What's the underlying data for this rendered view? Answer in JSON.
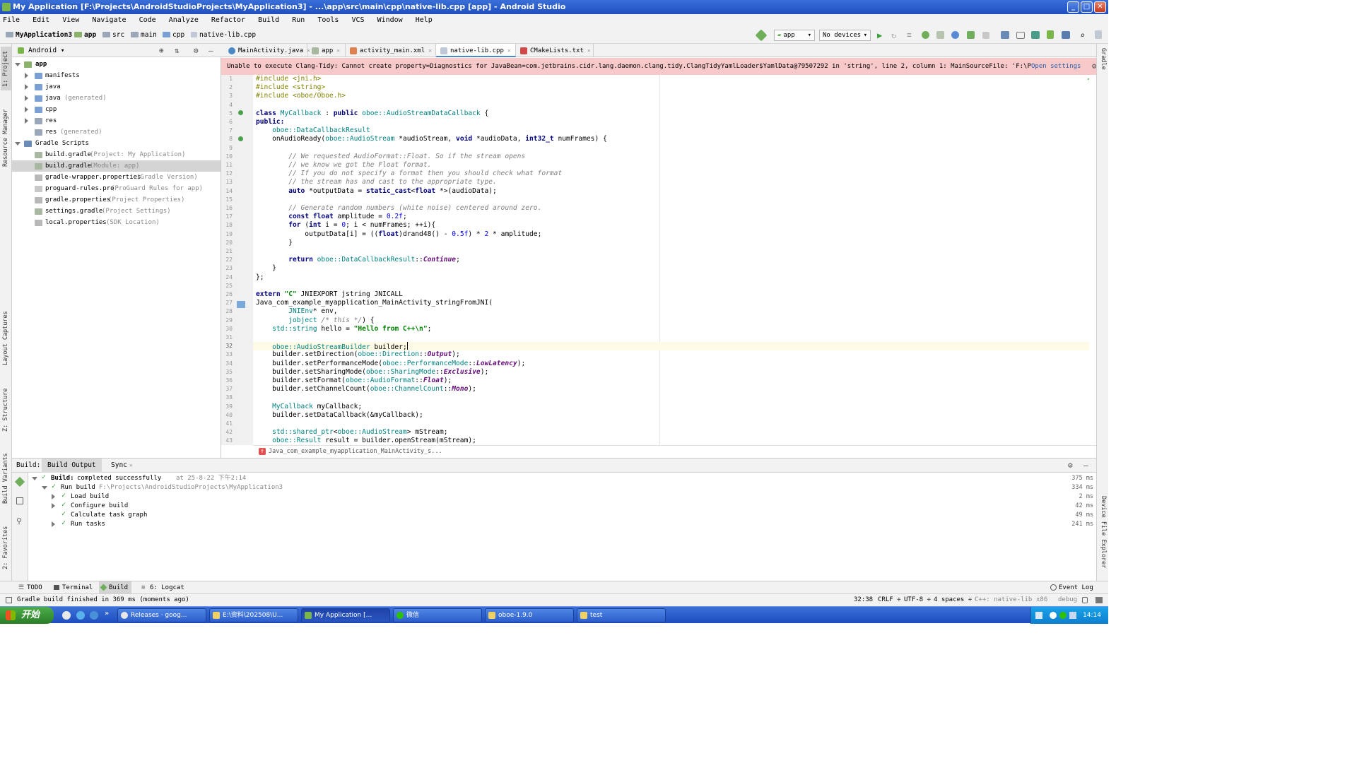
{
  "window": {
    "title": "My Application [F:\\Projects\\AndroidStudioProjects\\MyApplication3] - ...\\app\\src\\main\\cpp\\native-lib.cpp [app] - Android Studio",
    "minimize": "_",
    "maximize": "□",
    "close": "✕"
  },
  "menu": [
    "File",
    "Edit",
    "View",
    "Navigate",
    "Code",
    "Analyze",
    "Refactor",
    "Build",
    "Run",
    "Tools",
    "VCS",
    "Window",
    "Help"
  ],
  "breadcrumb": [
    "MyApplication3",
    "app",
    "src",
    "main",
    "cpp",
    "native-lib.cpp"
  ],
  "toolbar": {
    "run_config": "app",
    "device": "No devices"
  },
  "left_tool_tabs": [
    "1: Project",
    "Resource Manager",
    "Layout Captures",
    "Z: Structure",
    "Build Variants",
    "2: Favorites"
  ],
  "right_tool_tabs": [
    "Gradle",
    "Device File Explorer"
  ],
  "project_panel": {
    "view_mode": "Android",
    "tree": [
      {
        "label": "app",
        "note": ""
      },
      {
        "label": "manifests",
        "note": ""
      },
      {
        "label": "java",
        "note": ""
      },
      {
        "label": "java",
        "note": "(generated)"
      },
      {
        "label": "cpp",
        "note": ""
      },
      {
        "label": "res",
        "note": ""
      },
      {
        "label": "res",
        "note": "(generated)"
      },
      {
        "label": "Gradle Scripts",
        "note": ""
      },
      {
        "label": "build.gradle",
        "note": "(Project: My Application)"
      },
      {
        "label": "build.gradle",
        "note": "(Module: app)"
      },
      {
        "label": "gradle-wrapper.properties",
        "note": "(Gradle Version)"
      },
      {
        "label": "proguard-rules.pro",
        "note": "(ProGuard Rules for app)"
      },
      {
        "label": "gradle.properties",
        "note": "(Project Properties)"
      },
      {
        "label": "settings.gradle",
        "note": "(Project Settings)"
      },
      {
        "label": "local.properties",
        "note": "(SDK Location)"
      }
    ]
  },
  "editor_tabs": [
    "MainActivity.java",
    "app",
    "activity_main.xml",
    "native-lib.cpp",
    "CMakeLists.txt"
  ],
  "banner": {
    "message": "Unable to execute Clang-Tidy: Cannot create property=Diagnostics for JavaBean=com.jetbrains.cidr.lang.daemon.clang.tidy.ClangTidyYamlLoader$YamlData@79507292 in 'string', line 2, column 1:    MainSourceFile:  'F:\\Projects\\An ...",
    "link": "Open settings"
  },
  "code_lines": [
    "1",
    "2",
    "3",
    "4",
    "5",
    "6",
    "7",
    "8",
    "9",
    "10",
    "11",
    "12",
    "13",
    "14",
    "15",
    "16",
    "17",
    "18",
    "19",
    "20",
    "21",
    "22",
    "23",
    "24",
    "25",
    "26",
    "27",
    "28",
    "29",
    "30",
    "31",
    "32",
    "33",
    "34",
    "35",
    "36",
    "37",
    "38",
    "39",
    "40",
    "41",
    "42",
    "43"
  ],
  "code": {
    "l1": "#include <jni.h>",
    "l2": "#include <string>",
    "l3": "#include <oboe/Oboe.h>",
    "l5a": "class ",
    "l5b": "MyCallback",
    "l5c": " : ",
    "l5d": "public",
    "l5e": " oboe::",
    "l5f": "AudioStreamDataCallback",
    "l5g": " {",
    "l6": "public:",
    "l7a": "    oboe::",
    "l7b": "DataCallbackResult",
    "l8a": "    onAudioReady(",
    "l8b": "oboe::",
    "l8c": "AudioStream",
    "l8d": " *audioStream, ",
    "l8e": "void",
    "l8f": " *audioData, ",
    "l8g": "int32_t",
    "l8h": " numFrames) {",
    "l10": "        // We requested AudioFormat::Float. So if the stream opens",
    "l11": "        // we know we got the Float format.",
    "l12": "        // If you do not specify a format then you should check what format",
    "l13": "        // the stream has and cast to the appropriate type.",
    "l14a": "        ",
    "l14b": "auto",
    "l14c": " *outputData = ",
    "l14d": "static_cast",
    "l14e": "<",
    "l14f": "float",
    "l14g": " *>(audioData);",
    "l16": "        // Generate random numbers (white noise) centered around zero.",
    "l17a": "        ",
    "l17b": "const float",
    "l17c": " amplitude = ",
    "l17d": "0.2f",
    "l17e": ";",
    "l18a": "        ",
    "l18b": "for",
    "l18c": " (",
    "l18d": "int",
    "l18e": " i = ",
    "l18f": "0",
    "l18g": "; i < numFrames; ++i){",
    "l19a": "            outputData[i] = ((",
    "l19b": "float",
    "l19c": ")drand48() - ",
    "l19d": "0.5f",
    "l19e": ") * ",
    "l19f": "2",
    "l19g": " * amplitude;",
    "l20": "        }",
    "l22a": "        ",
    "l22b": "return",
    "l22c": " oboe::",
    "l22d": "DataCallbackResult",
    "l22e": "::",
    "l22f": "Continue",
    "l22g": ";",
    "l23": "    }",
    "l24": "};",
    "l26a": "extern ",
    "l26b": "\"C\"",
    "l26c": " JNIEXPORT jstring JNICALL",
    "l27": "Java_com_example_myapplication_MainActivity_stringFromJNI(",
    "l28a": "        ",
    "l28b": "JNIEnv",
    "l28c": "* env,",
    "l29a": "        ",
    "l29b": "jobject",
    "l29c": " /* this */",
    "l29d": ") {",
    "l30a": "    std::",
    "l30b": "string",
    "l30c": " hello = ",
    "l30d": "\"Hello from C++\\n\"",
    "l30e": ";",
    "l32a": "    oboe::",
    "l32b": "AudioStreamBuilder",
    "l32c": " builder;",
    "l33a": "    builder.setDirection(",
    "l33b": "oboe::",
    "l33c": "Direction",
    "l33d": "::",
    "l33e": "Output",
    "l33f": ");",
    "l34a": "    builder.setPerformanceMode(",
    "l34b": "oboe::",
    "l34c": "PerformanceMode",
    "l34d": "::",
    "l34e": "LowLatency",
    "l34f": ");",
    "l35a": "    builder.setSharingMode(",
    "l35b": "oboe::",
    "l35c": "SharingMode",
    "l35d": "::",
    "l35e": "Exclusive",
    "l35f": ");",
    "l36a": "    builder.setFormat(",
    "l36b": "oboe::",
    "l36c": "AudioFormat",
    "l36d": "::",
    "l36e": "Float",
    "l36f": ");",
    "l37a": "    builder.setChannelCount(",
    "l37b": "oboe::",
    "l37c": "ChannelCount",
    "l37d": "::",
    "l37e": "Mono",
    "l37f": ");",
    "l39a": "    ",
    "l39b": "MyCallback",
    "l39c": " myCallback;",
    "l40": "    builder.setDataCallback(&myCallback);",
    "l42a": "    std::",
    "l42b": "shared_ptr",
    "l42c": "<",
    "l42d": "oboe::AudioStream",
    "l42e": "> mStream;",
    "l43a": "    oboe::",
    "l43b": "Result",
    "l43c": " result = builder.openStream(mStream);"
  },
  "editor_breadcrumb": "Java_com_example_myapplication_MainActivity_s...",
  "build_panel": {
    "label": "Build:",
    "tabs": [
      "Build Output",
      "Sync"
    ],
    "rows": [
      {
        "text": "Build:",
        "detail": "completed successfully",
        "extra": "at 25-8-22 下午2:14",
        "time": "375 ms"
      },
      {
        "text": "Run build",
        "detail": "",
        "extra": "F:\\Projects\\AndroidStudioProjects\\MyApplication3",
        "time": "334 ms"
      },
      {
        "text": "Load build",
        "detail": "",
        "extra": "",
        "time": "2 ms"
      },
      {
        "text": "Configure build",
        "detail": "",
        "extra": "",
        "time": "42 ms"
      },
      {
        "text": "Calculate task graph",
        "detail": "",
        "extra": "",
        "time": "49 ms"
      },
      {
        "text": "Run tasks",
        "detail": "",
        "extra": "",
        "time": "241 ms"
      }
    ]
  },
  "bottom_tabs": [
    "TODO",
    "Terminal",
    "Build",
    "6: Logcat"
  ],
  "event_log": "Event Log",
  "status": {
    "message": "Gradle build finished in 369 ms (moments ago)",
    "position": "32:38",
    "line_sep": "CRLF",
    "encoding": "UTF-8",
    "indent": "4 spaces",
    "context": "C++: native-lib",
    "arch": "x86",
    "variant": "debug"
  },
  "taskbar": {
    "start": "开始",
    "items": [
      "Releases · goog...",
      "E:\\资料\\202508\\U...",
      "My Application [...",
      "微信",
      "oboe-1.9.0",
      "test"
    ],
    "clock": "14:14"
  },
  "colors": {
    "title_bar": "#1f4fc0",
    "banner_bg": "#f7c9c9",
    "keyword": "#000080",
    "type": "#008080",
    "comment": "#808080",
    "string": "#008000",
    "number": "#0000ff",
    "enum": "#660e7a",
    "success": "#2a9d2a",
    "taskbar": "#2e5fcc",
    "start_button": "#3a9a36"
  }
}
